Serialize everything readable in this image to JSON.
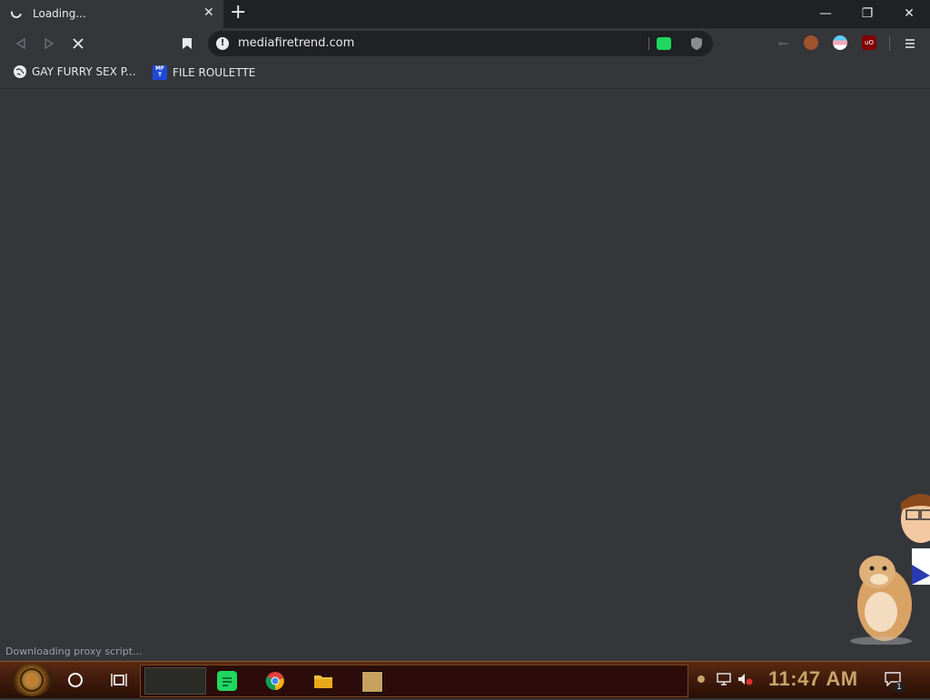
{
  "tab": {
    "title": "Loading...",
    "close_glyph": "✕"
  },
  "newtab_glyph": "+",
  "window": {
    "minimize": "—",
    "restore": "❐",
    "close": "✕"
  },
  "omnibox": {
    "url": "mediafiretrend.com",
    "info_glyph": "!"
  },
  "bookmarks": [
    {
      "label": "GAY FURRY SEX P...",
      "icon": "globe-icon"
    },
    {
      "label": "FILE ROULETTE",
      "icon": "mediafire-icon",
      "icon_text": "MF\nT"
    }
  ],
  "status_text": "Downloading proxy script...",
  "clock": "11:47 AM",
  "notification_count": "1",
  "colors": {
    "accent_green": "#1ed760",
    "taskbar": "#3a180a",
    "clock": "#c8a46a"
  }
}
